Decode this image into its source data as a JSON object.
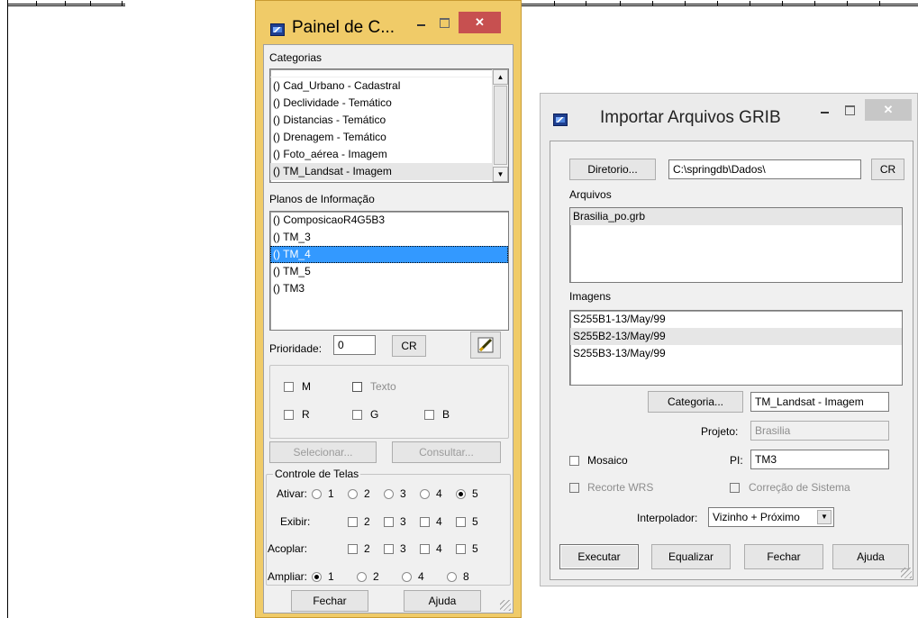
{
  "painel": {
    "title": "Painel de C...",
    "categorias_label": "Categorias",
    "categorias": [
      "() Cad_Urbano - Cadastral",
      "() Declividade - Temático",
      "() Distancias - Temático",
      "() Drenagem - Temático",
      "() Foto_aérea - Imagem",
      "() TM_Landsat - Imagem"
    ],
    "planos_label": "Planos de Informação",
    "planos": [
      "() ComposicaoR4G5B3",
      "() TM_3",
      "() TM_4",
      "() TM_5",
      "() TM3"
    ],
    "prioridade_label": "Prioridade:",
    "prioridade_value": "0",
    "cr_label": "CR",
    "check_m": "M",
    "check_texto": "Texto",
    "check_r": "R",
    "check_g": "G",
    "check_b": "B",
    "selecionar": "Selecionar...",
    "consultar": "Consultar...",
    "controle_label": "Controle de Telas",
    "ativar_label": "Ativar:",
    "exibir_label": "Exibir:",
    "acoplar_label": "Acoplar:",
    "ampliar_label": "Ampliar:",
    "ativar_opts": [
      "1",
      "2",
      "3",
      "4",
      "5"
    ],
    "exibir_opts": [
      "2",
      "3",
      "4",
      "5"
    ],
    "acoplar_opts": [
      "2",
      "3",
      "4",
      "5"
    ],
    "ampliar_opts": [
      "1",
      "2",
      "4",
      "8"
    ],
    "fechar": "Fechar",
    "ajuda": "Ajuda"
  },
  "grib": {
    "title": "Importar Arquivos GRIB",
    "diretorio_btn": "Diretorio...",
    "diretorio_value": "C:\\springdb\\Dados\\",
    "cr_label": "CR",
    "arquivos_label": "Arquivos",
    "arquivos": [
      "Brasilia_po.grb"
    ],
    "imagens_label": "Imagens",
    "imagens": [
      "S255B1-13/May/99",
      "S255B2-13/May/99",
      "S255B3-13/May/99"
    ],
    "categoria_btn": "Categoria...",
    "categoria_value": "TM_Landsat - Imagem",
    "projeto_label": "Projeto:",
    "projeto_value": "Brasilia",
    "mosaico_label": "Mosaico",
    "pi_label": "PI:",
    "pi_value": "TM3",
    "recorte_label": "Recorte WRS",
    "correcao_label": "Correção de Sistema",
    "interpolador_label": "Interpolador:",
    "interpolador_value": "Vizinho + Próximo",
    "executar": "Executar",
    "equalizar": "Equalizar",
    "fechar": "Fechar",
    "ajuda": "Ajuda"
  }
}
